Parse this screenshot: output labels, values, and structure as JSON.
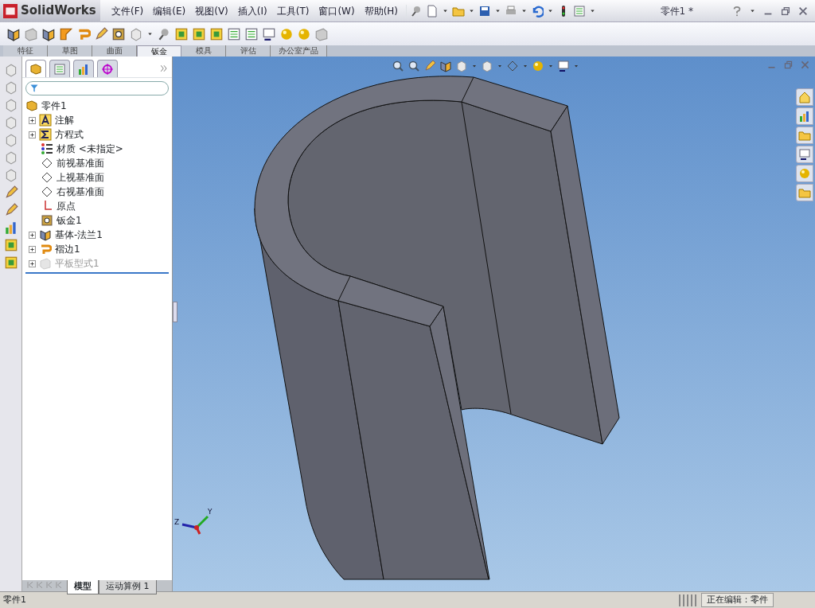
{
  "app": {
    "logo": "SolidWorks"
  },
  "menu": [
    {
      "label": "文件(F)"
    },
    {
      "label": "编辑(E)"
    },
    {
      "label": "视图(V)"
    },
    {
      "label": "插入(I)"
    },
    {
      "label": "工具(T)"
    },
    {
      "label": "窗口(W)"
    },
    {
      "label": "帮助(H)"
    }
  ],
  "document_title": "零件1 *",
  "ribbon_tabs": [
    {
      "label": "特征",
      "selected": false
    },
    {
      "label": "草图",
      "selected": false
    },
    {
      "label": "曲面",
      "selected": false
    },
    {
      "label": "钣金",
      "selected": true
    },
    {
      "label": "模具",
      "selected": false
    },
    {
      "label": "评估",
      "selected": false
    },
    {
      "label": "办公室产品",
      "selected": false
    }
  ],
  "panel_tabs": [
    {
      "kind": "tree",
      "selected": true
    },
    {
      "kind": "property",
      "selected": false
    },
    {
      "kind": "config",
      "selected": false
    },
    {
      "kind": "display",
      "selected": false
    }
  ],
  "feature_tree": {
    "root": "零件1",
    "items": [
      {
        "kind": "annotation",
        "label": "注解",
        "expandable": true,
        "suppressed": false
      },
      {
        "kind": "equation",
        "label": "方程式",
        "expandable": true,
        "suppressed": false
      },
      {
        "kind": "material",
        "label": "材质 <未指定>",
        "expandable": false,
        "suppressed": false
      },
      {
        "kind": "plane",
        "label": "前视基准面",
        "expandable": false,
        "suppressed": false
      },
      {
        "kind": "plane",
        "label": "上视基准面",
        "expandable": false,
        "suppressed": false
      },
      {
        "kind": "plane",
        "label": "右视基准面",
        "expandable": false,
        "suppressed": false
      },
      {
        "kind": "origin",
        "label": "原点",
        "expandable": false,
        "suppressed": false
      },
      {
        "kind": "sheetmetal",
        "label": "钣金1",
        "expandable": false,
        "suppressed": false
      },
      {
        "kind": "flange",
        "label": "基体-法兰1",
        "expandable": true,
        "suppressed": false
      },
      {
        "kind": "hem",
        "label": "褶边1",
        "expandable": true,
        "suppressed": false
      },
      {
        "kind": "flat",
        "label": "平板型式1",
        "expandable": true,
        "suppressed": true
      }
    ]
  },
  "bottom_tabs": [
    {
      "label": "模型",
      "selected": true
    },
    {
      "label": "运动算例 1",
      "selected": false
    }
  ],
  "triad": {
    "labels": [
      "Z",
      "Y"
    ]
  },
  "status_bar": {
    "document": "零件1",
    "mode": "正在编辑：零件"
  }
}
